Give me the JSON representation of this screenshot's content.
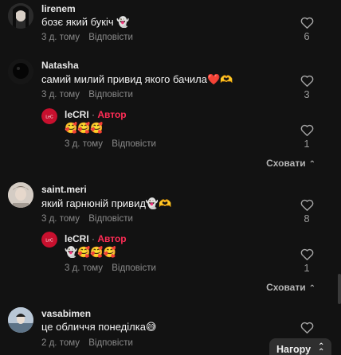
{
  "comments": [
    {
      "username": "lirenem",
      "text": "бозє який букіч 👻",
      "time": "3 д. тому",
      "reply_label": "Відповісти",
      "likes": "6",
      "avatar_color": "#2b2b2b"
    },
    {
      "username": "Natasha",
      "text": "самий милий привид якого бачила❤️🫶",
      "time": "3 д. тому",
      "reply_label": "Відповісти",
      "likes": "3",
      "avatar_color": "#1a1a1a",
      "reply": {
        "username": "leCRI",
        "separator": "·",
        "author_badge": "Автор",
        "text": "🥰🥰🥰",
        "time": "3 д. тому",
        "reply_label": "Відповісти",
        "likes": "1"
      },
      "hide_label": "Сховати"
    },
    {
      "username": "saint.meri",
      "text": "який гарнюній привид👻🫶",
      "time": "3 д. тому",
      "reply_label": "Відповісти",
      "likes": "8",
      "avatar_color": "#c9c2bb",
      "reply": {
        "username": "leCRI",
        "separator": "·",
        "author_badge": "Автор",
        "text": "👻🥰🥰🥰",
        "time": "3 д. тому",
        "reply_label": "Відповісти",
        "likes": "1"
      },
      "hide_label": "Сховати"
    },
    {
      "username": "vasabimen",
      "text": "це обличчя понеділка😅",
      "time": "2 д. тому",
      "reply_label": "Відповісти",
      "likes": "",
      "avatar_color": "#9fb3c8"
    }
  ],
  "author_avatar_color": "#c8102e",
  "back_to_top_label": "Нагору",
  "icons": {
    "like": "heart-outline-icon",
    "hide": "chevron-up-icon",
    "top": "double-chevron-up-icon"
  }
}
